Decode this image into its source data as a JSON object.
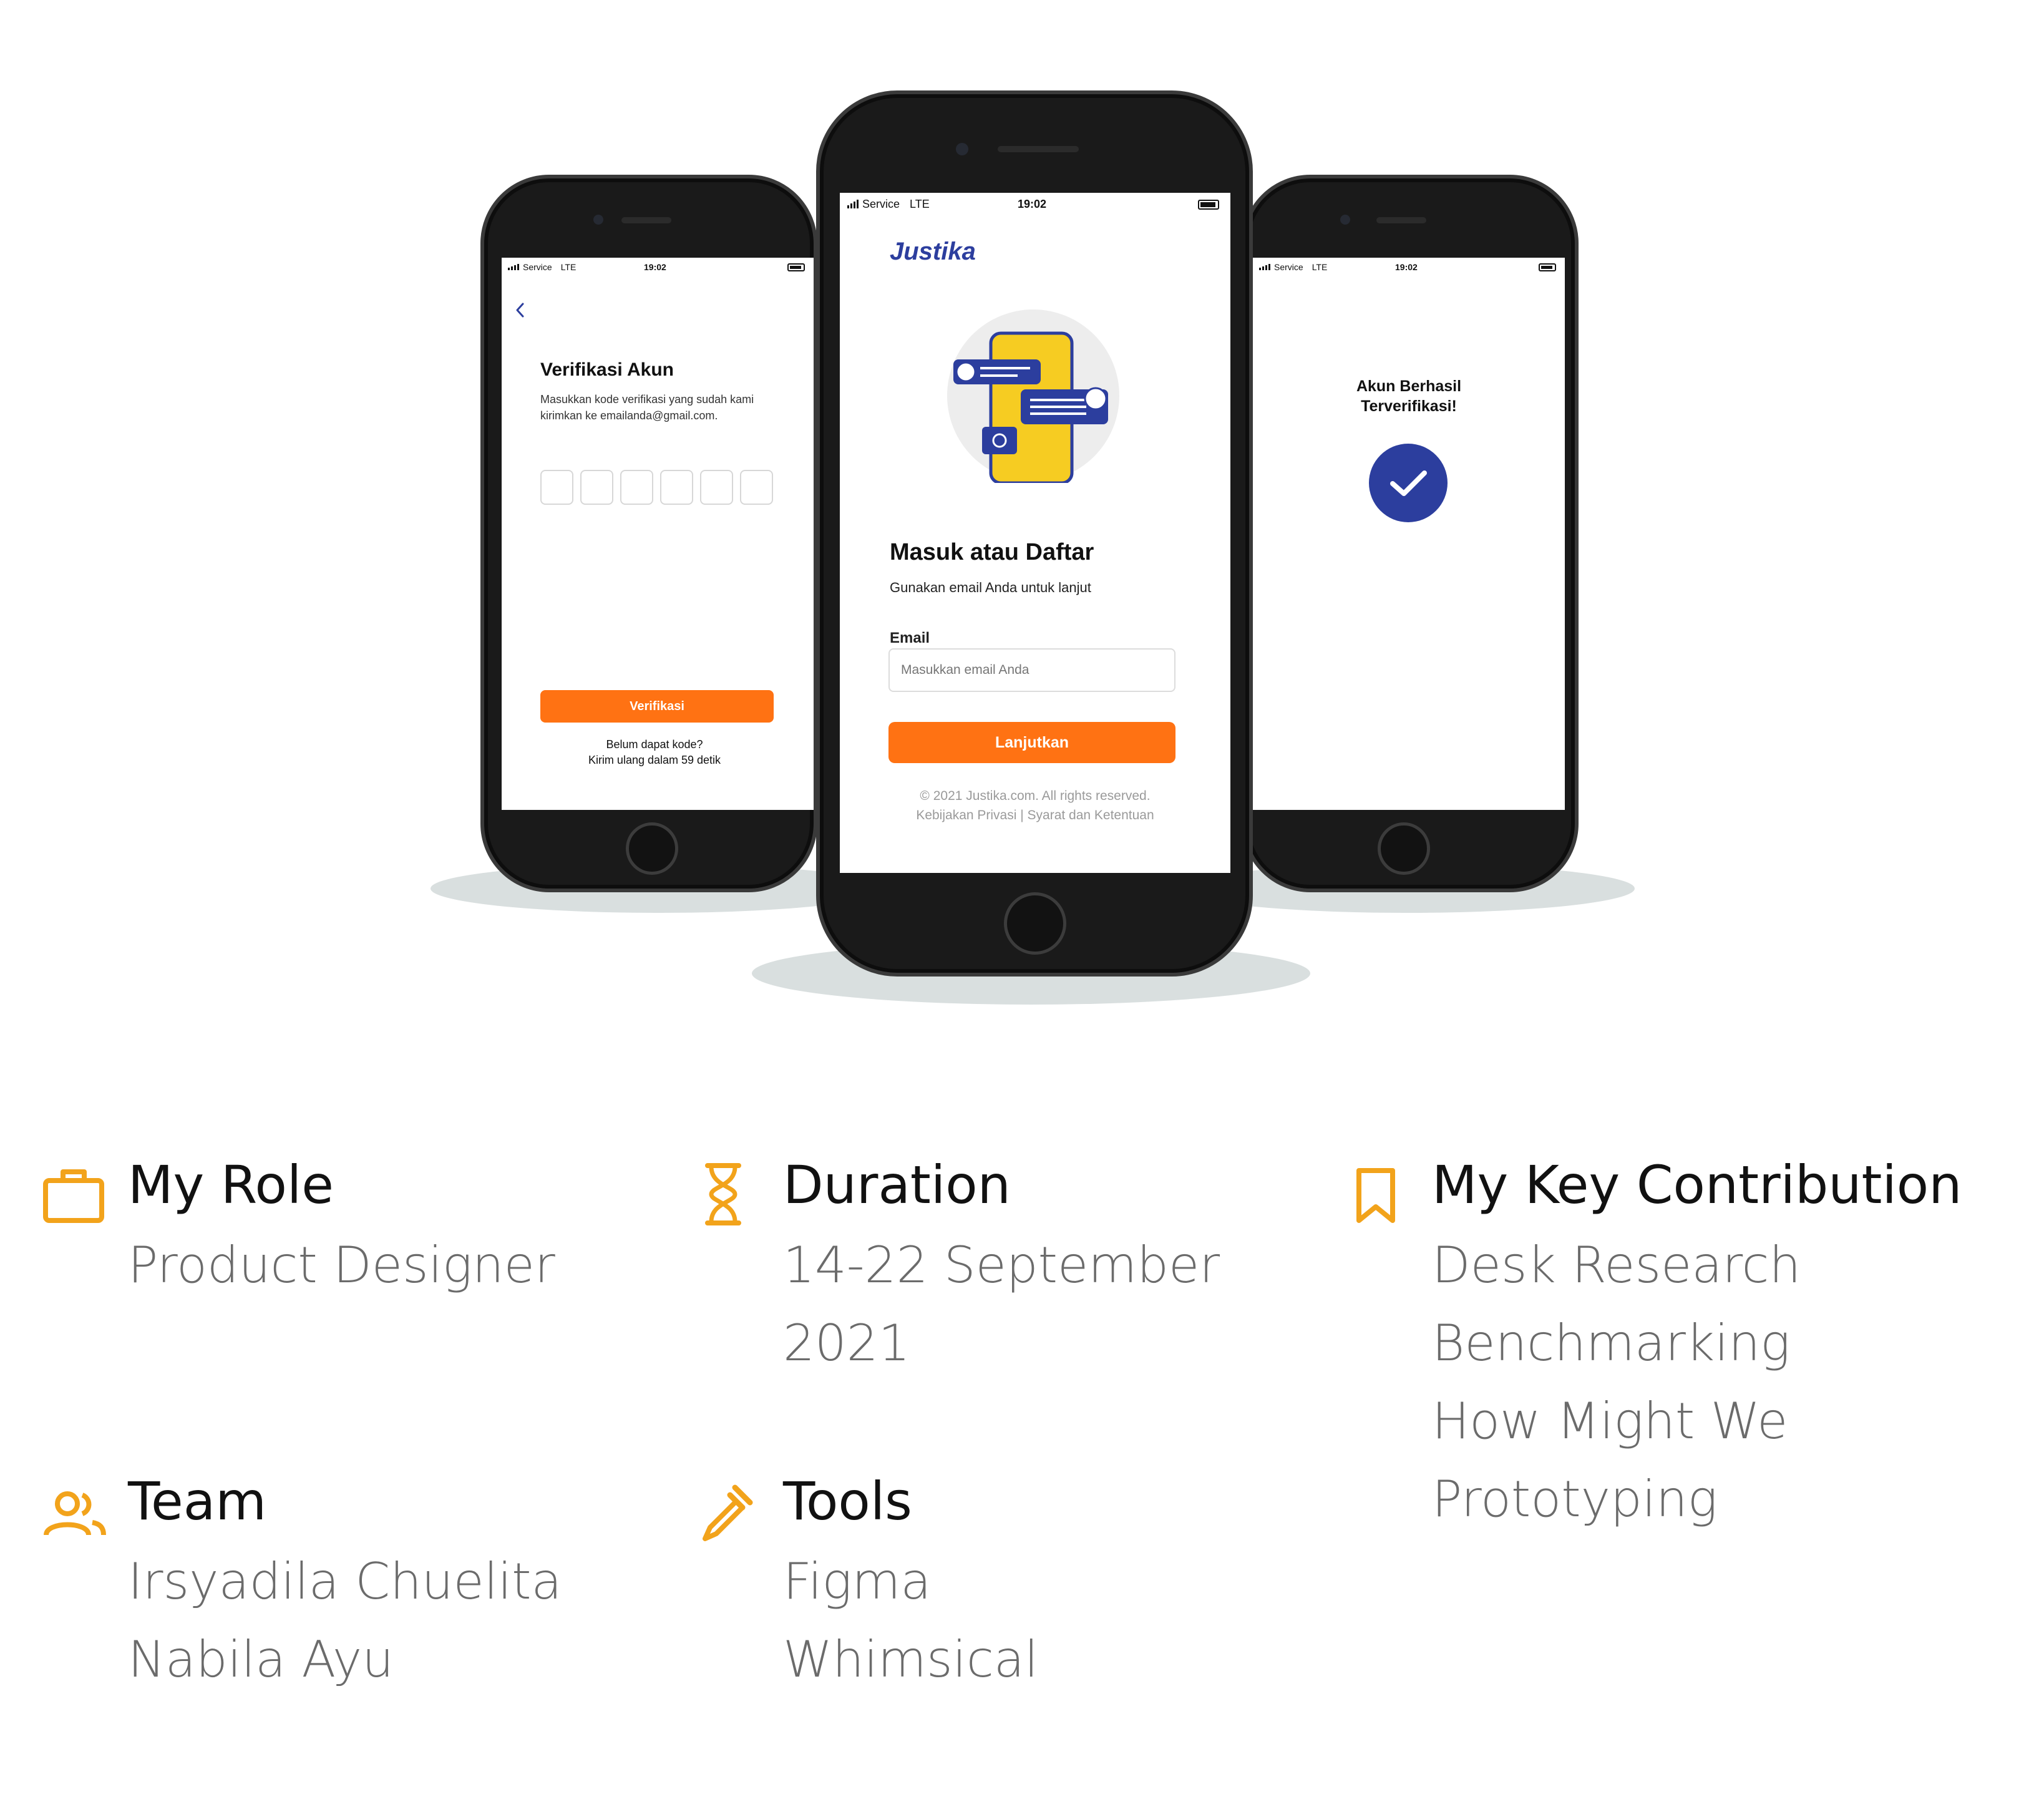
{
  "status_bar": {
    "carrier": "Service",
    "network": "LTE",
    "time": "19:02"
  },
  "phone_left": {
    "back_icon": "chevron-left-icon",
    "title": "Verifikasi Akun",
    "description_line1": "Masukkan kode verifikasi yang sudah kami",
    "description_line2": "kirimkan ke emailanda@gmail.com.",
    "otp_fields": 6,
    "button_label": "Verifikasi",
    "resend_line1": "Belum dapat kode?",
    "resend_line2": "Kirim ulang dalam 59 detik"
  },
  "phone_center": {
    "logo": "Justika",
    "title": "Masuk atau Daftar",
    "subtitle": "Gunakan email Anda untuk lanjut",
    "email_label": "Email",
    "email_placeholder": "Masukkan email Anda",
    "button_label": "Lanjutkan",
    "copyright": "© 2021 Justika.com. All rights reserved.",
    "policy_links": "Kebijakan Privasi | Syarat dan Ketentuan"
  },
  "phone_right": {
    "title_line1": "Akun Berhasil",
    "title_line2": "Terverifikasi!",
    "icon": "check-circle-icon"
  },
  "colors": {
    "accent_orange": "#ff7213",
    "brand_blue": "#2c3e9e",
    "icon_yellow": "#f2a31b"
  },
  "info": {
    "role": {
      "title": "My Role",
      "value": "Product Designer",
      "icon": "briefcase-icon"
    },
    "duration": {
      "title": "Duration",
      "value_line1": "14-22 September",
      "value_line2": "2021",
      "icon": "hourglass-icon"
    },
    "contribution": {
      "title": "My Key Contribution",
      "items": [
        "Desk Research",
        "Benchmarking",
        "How Might We",
        "Prototyping"
      ],
      "icon": "bookmark-icon"
    },
    "team": {
      "title": "Team",
      "members": [
        "Irsyadila Chuelita",
        "Nabila Ayu"
      ],
      "icon": "users-icon"
    },
    "tools": {
      "title": "Tools",
      "items": [
        "Figma",
        "Whimsical"
      ],
      "icon": "eyedropper-icon"
    }
  }
}
